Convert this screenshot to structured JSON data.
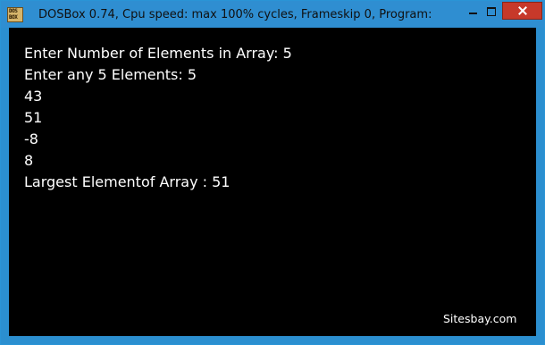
{
  "window": {
    "title": "DOSBox 0.74, Cpu speed: max 100% cycles, Frameskip  0, Program:",
    "app_icon": "dosbox-icon",
    "app_icon_text": [
      "DOS",
      "BOX"
    ],
    "controls": [
      "minimize-icon",
      "maximize-icon",
      "close-icon"
    ],
    "title_bar_color": "#2f8ed1",
    "close_button_color": "#c7392a"
  },
  "console": {
    "background": "#000000",
    "foreground": "#ffffff",
    "lines": [
      "Enter Number of Elements in Array: 5",
      "Enter any 5 Elements: 5",
      "43",
      "51",
      "-8",
      "8",
      "Largest Elementof Array : 51"
    ]
  },
  "watermark": "Sitesbay.com"
}
